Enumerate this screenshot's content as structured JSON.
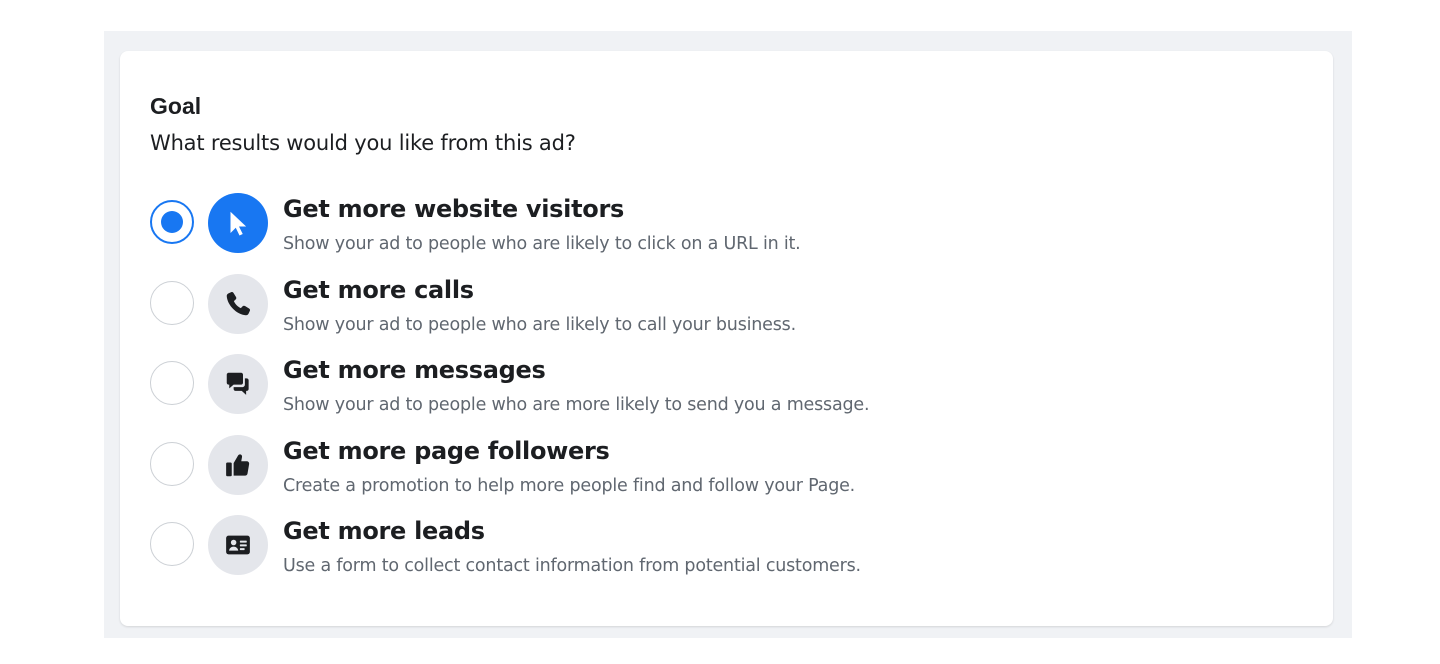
{
  "goal": {
    "title": "Goal",
    "subtitle": "What results would you like from this ad?",
    "selected_index": 0,
    "options": [
      {
        "title": "Get more website visitors",
        "description": "Show your ad to people who are likely to click on a URL in it.",
        "icon": "cursor-icon"
      },
      {
        "title": "Get more calls",
        "description": "Show your ad to people who are likely to call your business.",
        "icon": "phone-icon"
      },
      {
        "title": "Get more messages",
        "description": "Show your ad to people who are more likely to send you a message.",
        "icon": "chat-bubbles-icon"
      },
      {
        "title": "Get more page followers",
        "description": "Create a promotion to help more people find and follow your Page.",
        "icon": "thumbs-up-icon"
      },
      {
        "title": "Get more leads",
        "description": "Use a form to collect contact information from potential customers.",
        "icon": "contact-card-icon"
      }
    ]
  },
  "colors": {
    "accent": "#1877f2",
    "icon_background": "#e4e6eb",
    "icon_glyph": "#1c1e21",
    "text_primary": "#1c1e21",
    "text_secondary": "#606770"
  }
}
